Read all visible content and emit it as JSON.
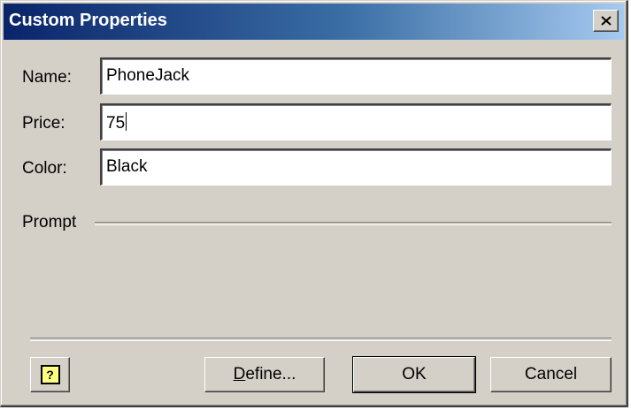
{
  "window": {
    "title": "Custom Properties"
  },
  "fields": [
    {
      "label": "Name:",
      "value": "PhoneJack"
    },
    {
      "label": "Price:",
      "value": "75"
    },
    {
      "label": "Color:",
      "value": "Black"
    }
  ],
  "prompt": {
    "label": "Prompt"
  },
  "buttons": {
    "define_pre": "",
    "define_mnemonic": "D",
    "define_post": "efine...",
    "ok": "OK",
    "cancel": "Cancel",
    "help_glyph": "?"
  },
  "icons": {
    "close": "close-icon",
    "help": "help-icon"
  },
  "colors": {
    "titlebar_start": "#0a246a",
    "titlebar_end": "#a6caf0",
    "face": "#d4d0c8"
  }
}
